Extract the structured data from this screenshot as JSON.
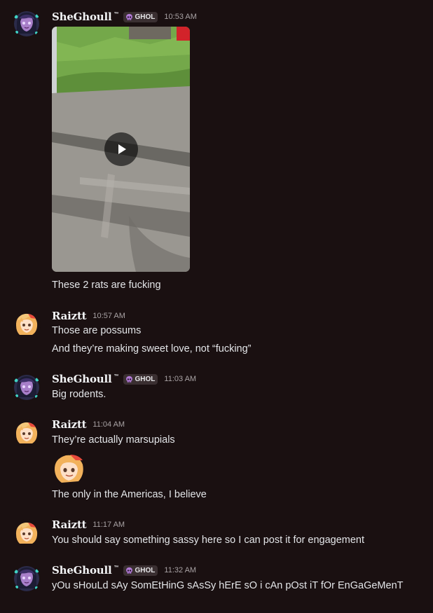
{
  "messages": [
    {
      "author": "SheGhoull",
      "author_suffix": "™",
      "tag": "GHOL",
      "time": "10:53 AM",
      "attachment": "video",
      "lines": [
        "These 2 rats are fucking"
      ]
    },
    {
      "author": "Raiztt",
      "time": "10:57 AM",
      "lines": [
        "Those are possums",
        "And they’re making sweet love, not “fucking”"
      ]
    },
    {
      "author": "SheGhoull",
      "author_suffix": "™",
      "tag": "GHOL",
      "time": "11:03 AM",
      "lines": [
        "Big rodents."
      ]
    },
    {
      "author": "Raiztt",
      "time": "11:04 AM",
      "lines": [
        "They’re actually marsupials",
        "The only in the Americas, I believe"
      ],
      "emoji": "raiztt-face-emoji"
    },
    {
      "author": "Raiztt",
      "time": "11:17 AM",
      "lines": [
        "You should say something sassy here so I can post it for engagement"
      ]
    },
    {
      "author": "SheGhoull",
      "author_suffix": "™",
      "tag": "GHOL",
      "time": "11:32 AM",
      "lines": [
        "yOu sHouLd sAy SomEtHinG sAsSy hErE sO i cAn pOst iT fOr EnGaGeMenT"
      ]
    }
  ],
  "icons": {
    "tag_icon": "skull-icon",
    "video_control": "play-icon"
  },
  "colors": {
    "background": "#1a1011",
    "text": "#e3e5e8",
    "timestamp": "#a8a2a4",
    "tag_bg": "#3a2f31",
    "skull": "#b27ad6"
  }
}
